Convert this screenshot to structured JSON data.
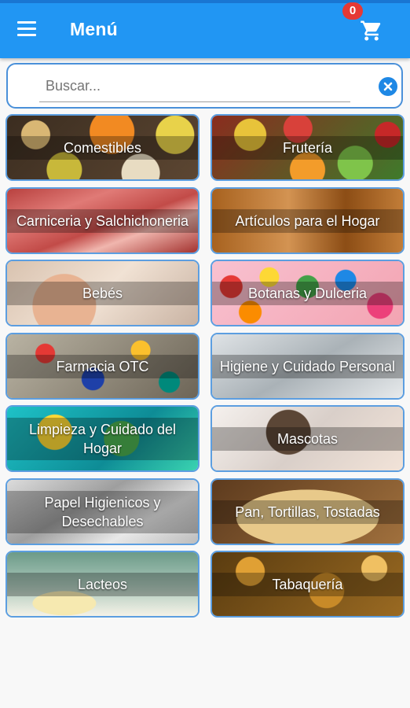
{
  "appbar": {
    "title": "Menú",
    "menu_icon": "hamburger-menu-icon",
    "cart_icon": "shopping-cart-icon",
    "cart_count": "0",
    "color": "#2196f3"
  },
  "search": {
    "placeholder": "Buscar...",
    "value": "",
    "clear_icon": "close-circle-icon"
  },
  "categories": [
    {
      "label": "Comestibles"
    },
    {
      "label": "Frutería"
    },
    {
      "label": "Carniceria y Salchichoneria"
    },
    {
      "label": "Artículos para el Hogar"
    },
    {
      "label": "Bebés"
    },
    {
      "label": "Botanas y Dulceria"
    },
    {
      "label": "Farmacia OTC"
    },
    {
      "label": "Higiene y Cuidado Personal"
    },
    {
      "label": "Limpieza y Cuidado del Hogar"
    },
    {
      "label": "Mascotas"
    },
    {
      "label": "Papel Higienicos y Desechables"
    },
    {
      "label": "Pan, Tortillas, Tostadas"
    },
    {
      "label": "Lacteos"
    },
    {
      "label": "Tabaquería"
    }
  ]
}
